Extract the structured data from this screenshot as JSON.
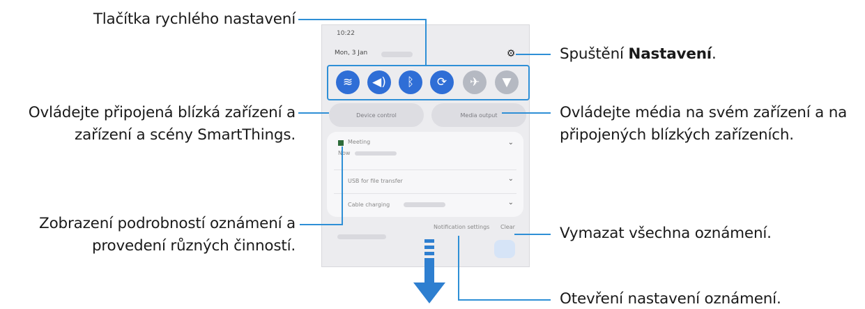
{
  "labels": {
    "quick_settings_buttons": "Tlačítka rychlého nastavení",
    "launch_settings_prefix": "Spuštění ",
    "launch_settings_bold": "Nastavení",
    "launch_settings_suffix": ".",
    "smartthings_line1": "Ovládejte připojená blízká zařízení a",
    "smartthings_line2": "zařízení a scény SmartThings.",
    "media_line1": "Ovládejte média na svém zařízení a na",
    "media_line2": "připojených blízkých zařízeních.",
    "notif_details_line1": "Zobrazení podrobností oznámení a",
    "notif_details_line2": "provedení různých činností.",
    "clear_all": "Vymazat všechna oznámení.",
    "open_notif_settings": "Otevření nastavení oznámení."
  },
  "phone": {
    "time": "10:22",
    "date": "Mon, 3 Jan",
    "quick_buttons": [
      {
        "icon": "wifi-icon",
        "glyph": "≋",
        "state": "on"
      },
      {
        "icon": "sound-icon",
        "glyph": "◀)",
        "state": "on"
      },
      {
        "icon": "bluetooth-icon",
        "glyph": "ᛒ",
        "state": "on"
      },
      {
        "icon": "auto-rotate-icon",
        "glyph": "⟳",
        "state": "on"
      },
      {
        "icon": "airplane-mode-icon",
        "glyph": "✈",
        "state": "off"
      },
      {
        "icon": "flashlight-icon",
        "glyph": "▼",
        "state": "off"
      }
    ],
    "device_control": "Device control",
    "media_output": "Media output",
    "notifications": [
      {
        "title": "Meeting",
        "sub": "Now"
      },
      {
        "title": "USB for file transfer",
        "sub": ""
      },
      {
        "title": "Cable charging",
        "sub": ""
      }
    ],
    "notification_settings": "Notification settings",
    "clear": "Clear"
  },
  "colors": {
    "accent_line": "#2e8fd6",
    "toggle_on": "#2f6ed6",
    "toggle_off": "#b5b9c2",
    "arrow": "#2e7fd0"
  }
}
